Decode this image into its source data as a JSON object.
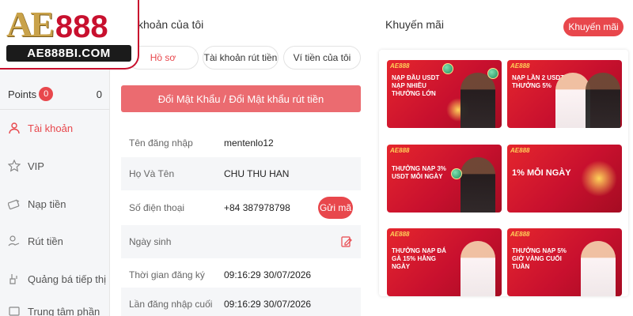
{
  "brand": {
    "logo_main": "AE",
    "logo_num": "888",
    "logo_domain": "AE888BI.COM"
  },
  "sidebar": {
    "points_label": "Points",
    "points_badge": "0",
    "points_value": "0",
    "items": [
      {
        "label": "Tài khoản",
        "icon": "user-icon",
        "active": true
      },
      {
        "label": "VIP",
        "icon": "vip-star-icon",
        "active": false
      },
      {
        "label": "Nạp tiền",
        "icon": "deposit-icon",
        "active": false
      },
      {
        "label": "Rút tiền",
        "icon": "withdraw-icon",
        "active": false
      },
      {
        "label": "Quảng bá tiếp thị",
        "icon": "marketing-icon",
        "active": false
      },
      {
        "label": "Trung tâm phần",
        "icon": "center-icon",
        "active": false
      }
    ]
  },
  "account": {
    "title": "khoản của tôi",
    "tabs": [
      "Hồ sơ",
      "Tài khoản rút tiền",
      "Ví tiền của tôi"
    ],
    "change_password_button": "Đổi Mật Khẩu / Đổi Mật khẩu rút tiền",
    "fields": [
      {
        "label": "Tên đăng nhập",
        "value": "mentenlo12"
      },
      {
        "label": "Họ Và Tên",
        "value": "CHU THU HAN"
      },
      {
        "label": "Số điện thoại",
        "value": "+84 387978798"
      },
      {
        "label": "Ngày sinh",
        "value": ""
      },
      {
        "label": "Thời gian đăng ký",
        "value": "09:16:29 30/07/2026"
      },
      {
        "label": "Lần đăng nhập cuối",
        "value": "09:16:29 30/07/2026"
      }
    ],
    "send_code_button": "Gửi mã"
  },
  "promotions": {
    "title": "Khuyến mãi",
    "button": "Khuyến mãi",
    "cards": [
      {
        "brand": "AE888",
        "text": "NẠP ĐẦU USDT NẠP NHIỀU THƯỞNG LỚN"
      },
      {
        "brand": "AE888",
        "text": "NẠP LẦN 2 USDT THƯỞNG 5%"
      },
      {
        "brand": "AE888",
        "text": "THƯỞNG NẠP 3% USDT MỖI NGÀY"
      },
      {
        "brand": "AE888",
        "text": "1% MỖI NGÀY"
      },
      {
        "brand": "AE888",
        "text": "THƯỞNG NẠP ĐÁ GÀ 15% HẰNG NGÀY"
      },
      {
        "brand": "AE888",
        "text": "THƯỞNG NẠP 5% GIỜ VÀNG CUỐI TUẦN"
      }
    ]
  },
  "colors": {
    "accent": "#e8474c",
    "button_soft": "#eb6b70",
    "brand_red": "#c8102e",
    "brand_gold": "#c9a24a"
  }
}
